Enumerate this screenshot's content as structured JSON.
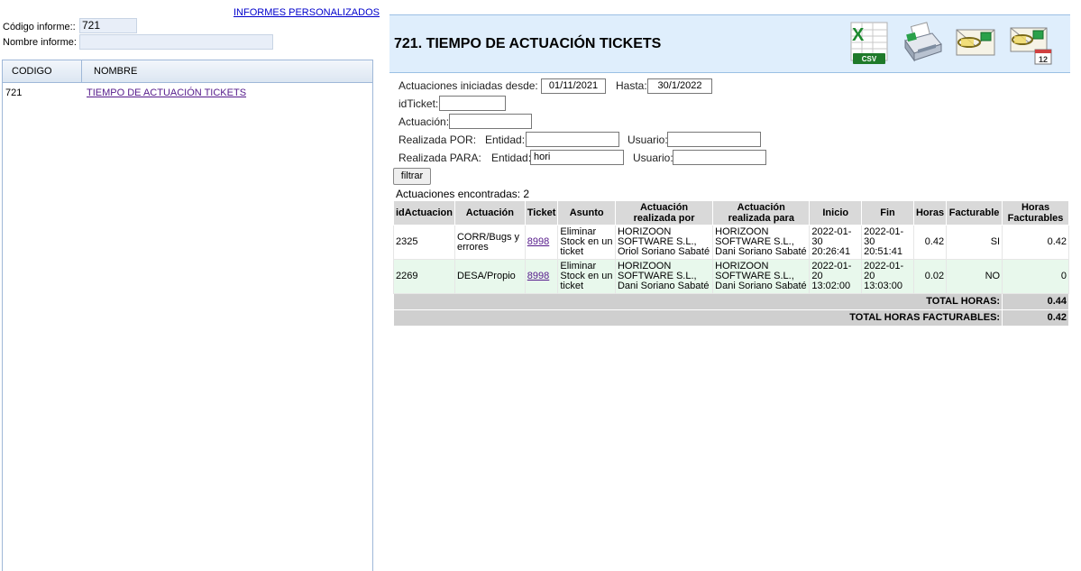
{
  "left": {
    "top_link": "INFORMES PERSONALIZADOS",
    "code_label": "Código informe::",
    "code_value": "721",
    "name_label": "Nombre informe:",
    "name_value": "",
    "list_headers": [
      "CODIGO",
      "NOMBRE"
    ],
    "list_rows": [
      {
        "code": "721",
        "name": "TIEMPO DE ACTUACIÓN TICKETS"
      }
    ]
  },
  "report": {
    "title": "721. TIEMPO DE ACTUACIÓN TICKETS",
    "tools": [
      "csv-export-icon",
      "print-icon",
      "email-icon",
      "scheduled-email-icon"
    ],
    "csv_text": "CSV",
    "sched_number": "12"
  },
  "filters": {
    "desde_label": "Actuaciones iniciadas desde:",
    "desde_value": "01/11/2021",
    "hasta_label": "Hasta:",
    "hasta_value": "30/1/2022",
    "idticket_label": "idTicket:",
    "idticket_value": "",
    "actuacion_label": "Actuación:",
    "actuacion_value": "",
    "por_label": "Realizada POR:",
    "por_entidad_label": "Entidad:",
    "por_entidad_value": "",
    "por_usuario_label": "Usuario:",
    "por_usuario_value": "",
    "para_label": "Realizada PARA:",
    "para_entidad_label": "Entidad:",
    "para_entidad_value": "hori",
    "para_usuario_label": "Usuario:",
    "para_usuario_value": "",
    "button": "filtrar"
  },
  "results": {
    "found_text": "Actuaciones encontradas: 2",
    "headers": [
      "idActuacion",
      "Actuación",
      "Ticket",
      "Asunto",
      "Actuación realizada por",
      "Actuación realizada para",
      "Inicio",
      "Fin",
      "Horas",
      "Facturable",
      "Horas Facturables"
    ],
    "rows": [
      {
        "id": "2325",
        "actuacion": "CORR/Bugs y errores",
        "ticket": "8998",
        "asunto": "Eliminar Stock en un ticket",
        "por": "HORIZOON SOFTWARE S.L., Oriol Soriano Sabaté",
        "para": "HORIZOON SOFTWARE S.L., Dani Soriano Sabaté",
        "inicio": "2022-01-30 20:26:41",
        "fin": "2022-01-30 20:51:41",
        "horas": "0.42",
        "facturable": "SI",
        "horas_fact": "0.42"
      },
      {
        "id": "2269",
        "actuacion": "DESA/Propio",
        "ticket": "8998",
        "asunto": "Eliminar Stock en un ticket",
        "por": "HORIZOON SOFTWARE S.L., Dani Soriano Sabaté",
        "para": "HORIZOON SOFTWARE S.L., Dani Soriano Sabaté",
        "inicio": "2022-01-20 13:02:00",
        "fin": "2022-01-20 13:03:00",
        "horas": "0.02",
        "facturable": "NO",
        "horas_fact": "0"
      }
    ],
    "total_horas_label": "TOTAL HORAS:",
    "total_horas": "0.44",
    "total_fact_label": "TOTAL HORAS FACTURABLES:",
    "total_fact": "0.42"
  }
}
